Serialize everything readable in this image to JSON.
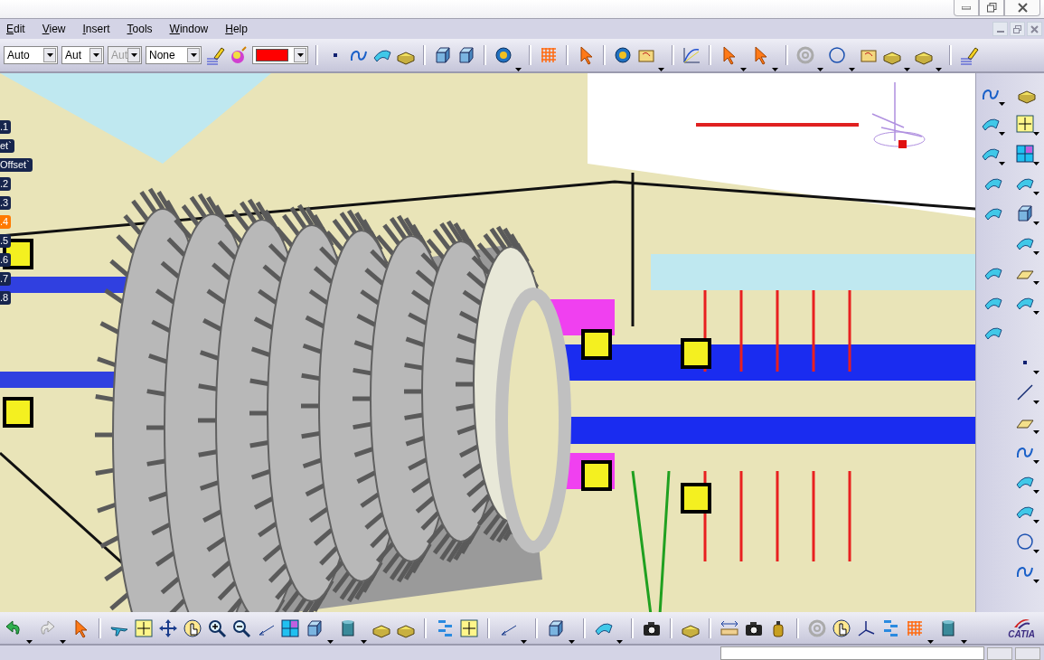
{
  "menu": [
    {
      "label": "Edit"
    },
    {
      "label": "View"
    },
    {
      "label": "Insert"
    },
    {
      "label": "Tools"
    },
    {
      "label": "Window"
    },
    {
      "label": "Help"
    }
  ],
  "toolbar": {
    "combos": [
      {
        "value": "Auto",
        "disabled": false
      },
      {
        "value": "Aut",
        "disabled": false
      },
      {
        "value": "Aut",
        "disabled": true
      },
      {
        "value": "None",
        "disabled": false
      }
    ],
    "color_combo": {
      "color": "#ff0000"
    }
  },
  "tree": [
    {
      "label": ".1",
      "selected": false
    },
    {
      "label": "et`",
      "selected": false
    },
    {
      "label": "Offset`",
      "selected": false
    },
    {
      "label": ".2",
      "selected": false
    },
    {
      "label": ".3",
      "selected": false
    },
    {
      "label": ".4",
      "selected": true
    },
    {
      "label": ".5",
      "selected": false
    },
    {
      "label": ".6",
      "selected": false
    },
    {
      "label": ".7",
      "selected": false
    },
    {
      "label": ".8",
      "selected": false
    }
  ],
  "logo": {
    "text": "CATIA"
  }
}
